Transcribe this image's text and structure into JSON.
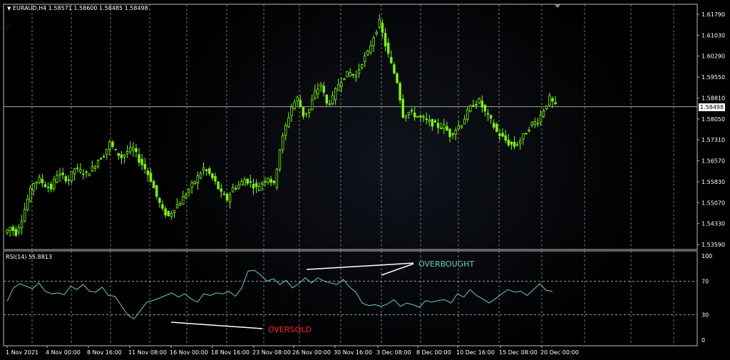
{
  "header": {
    "symbol_line": "EURAUD,H4  1.58571 1.58600 1.58485 1.58498",
    "current_price": "1.58498"
  },
  "rsi_header": "RSI(14) 55.8813",
  "annotations": {
    "overbought": "OVERBOUGHT",
    "oversold": "OVERSOLD"
  },
  "colors": {
    "background": "#000000",
    "candles": "#7CFC00",
    "rsi_line": "#66CCCC",
    "overbought": "#66CCCC",
    "oversold": "#FF2222",
    "grid": "#cfcfcf"
  },
  "chart_data": [
    {
      "type": "candlestick",
      "title": "EURAUD,H4",
      "ylim": [
        1.5359,
        1.6179
      ],
      "price_ticks": [
        "1.61790",
        "1.61030",
        "1.60290",
        "1.59550",
        "1.58810",
        "1.58050",
        "1.57310",
        "1.56570",
        "1.55830",
        "1.55070",
        "1.54330",
        "1.53590"
      ],
      "time_labels": [
        "1 Nov 2021",
        "4 Nov 00:00",
        "8 Nov 16:00",
        "11 Nov 08:00",
        "16 Nov 00:00",
        "18 Nov 16:00",
        "23 Nov 08:00",
        "26 Nov 00:00",
        "30 Nov 16:00",
        "3 Dec 08:00",
        "8 Dec 00:00",
        "10 Dec 16:00",
        "15 Dec 08:00",
        "20 Dec 00:00"
      ],
      "close_path": [
        1.542,
        1.54,
        1.545,
        1.552,
        1.558,
        1.559,
        1.557,
        1.556,
        1.561,
        1.56,
        1.559,
        1.563,
        1.562,
        1.561,
        1.563,
        1.566,
        1.568,
        1.572,
        1.569,
        1.567,
        1.569,
        1.57,
        1.566,
        1.563,
        1.559,
        1.553,
        1.548,
        1.546,
        1.549,
        1.551,
        1.554,
        1.557,
        1.56,
        1.563,
        1.561,
        1.558,
        1.554,
        1.552,
        1.556,
        1.557,
        1.559,
        1.558,
        1.556,
        1.558,
        1.56,
        1.557,
        1.57,
        1.578,
        1.585,
        1.588,
        1.582,
        1.584,
        1.59,
        1.593,
        1.586,
        1.588,
        1.593,
        1.596,
        1.597,
        1.596,
        1.601,
        1.604,
        1.61,
        1.615,
        1.607,
        1.6,
        1.594,
        1.582,
        1.583,
        1.582,
        1.581,
        1.58,
        1.579,
        1.578,
        1.578,
        1.575,
        1.577,
        1.579,
        1.583,
        1.586,
        1.587,
        1.583,
        1.58,
        1.576,
        1.574,
        1.572,
        1.571,
        1.573,
        1.576,
        1.579,
        1.58,
        1.584,
        1.588,
        1.585
      ]
    },
    {
      "type": "line",
      "title": "RSI(14) 55.8813",
      "ylim": [
        0,
        100
      ],
      "levels": [
        30,
        70
      ],
      "level_labels": [
        "100",
        "70",
        "30",
        "0"
      ],
      "values": [
        46,
        62,
        67,
        64,
        61,
        68,
        58,
        55,
        56,
        54,
        64,
        60,
        66,
        58,
        57,
        63,
        53,
        52,
        41,
        30,
        25,
        35,
        45,
        47,
        50,
        53,
        56,
        51,
        55,
        49,
        45,
        55,
        53,
        56,
        55,
        58,
        52,
        62,
        82,
        83,
        77,
        70,
        73,
        66,
        71,
        62,
        67,
        74,
        68,
        74,
        70,
        68,
        66,
        72,
        63,
        57,
        44,
        41,
        42,
        40,
        43,
        48,
        40,
        44,
        42,
        39,
        47,
        45,
        47,
        48,
        44,
        55,
        51,
        60,
        53,
        49,
        44,
        49,
        55,
        60,
        57,
        58,
        53,
        60,
        67,
        59,
        58
      ]
    }
  ]
}
